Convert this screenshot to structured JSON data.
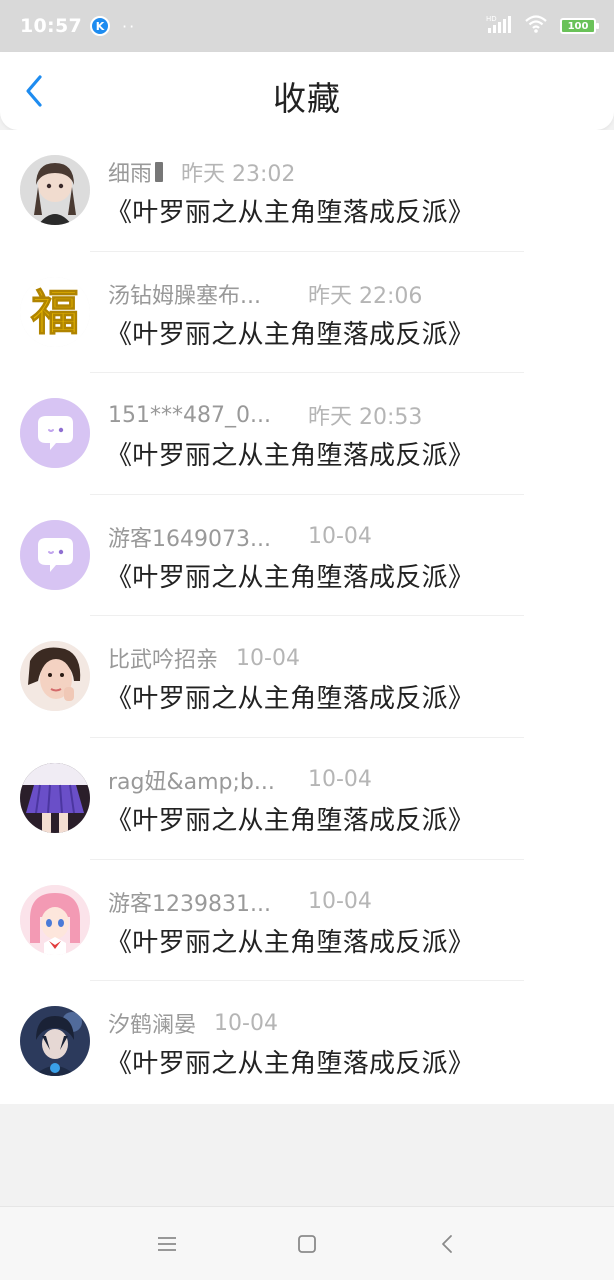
{
  "status_bar": {
    "time": "10:57",
    "app_icon_letter": "K",
    "dots": "··",
    "signal_label": "HD",
    "battery": "100"
  },
  "header": {
    "title": "收藏",
    "back_icon": "chevron-left-icon"
  },
  "colors": {
    "accent": "#1e8cf0",
    "status_bar_bg": "#d9d9d9",
    "title_text": "#222222",
    "meta_text": "#999999",
    "time_text": "#b5b5b5",
    "battery_fill": "#6ac259"
  },
  "favorites": [
    {
      "username": "细雨",
      "time": "昨天 23:02",
      "title": "《叶罗丽之从主角堕落成反派》",
      "avatar": "anime-girl-avatar"
    },
    {
      "username": "汤钻姆臊塞布...",
      "time": "昨天 22:06",
      "title": "《叶罗丽之从主角堕落成反派》",
      "avatar": "fu-character-avatar"
    },
    {
      "username": "151***487_0...",
      "time": "昨天 20:53",
      "title": "《叶罗丽之从主角堕落成反派》",
      "avatar": "default-chat-avatar"
    },
    {
      "username": "游客1649073...",
      "time": "10-04",
      "title": "《叶罗丽之从主角堕落成反派》",
      "avatar": "default-chat-avatar"
    },
    {
      "username": "比武吟招亲",
      "time": "10-04",
      "title": "《叶罗丽之从主角堕落成反派》",
      "avatar": "photo-avatar"
    },
    {
      "username": "rag妞&amp;b...",
      "time": "10-04",
      "title": "《叶罗丽之从主角堕落成反派》",
      "avatar": "purple-skirt-avatar"
    },
    {
      "username": "游客1239831...",
      "time": "10-04",
      "title": "《叶罗丽之从主角堕落成反派》",
      "avatar": "pink-anime-avatar"
    },
    {
      "username": "汐鹤澜晏",
      "time": "10-04",
      "title": "《叶罗丽之从主角堕落成反派》",
      "avatar": "dark-anime-avatar"
    }
  ],
  "nav_bar": {
    "menu_icon": "menu-icon",
    "home_icon": "home-square-icon",
    "back_icon": "back-triangle-icon"
  }
}
